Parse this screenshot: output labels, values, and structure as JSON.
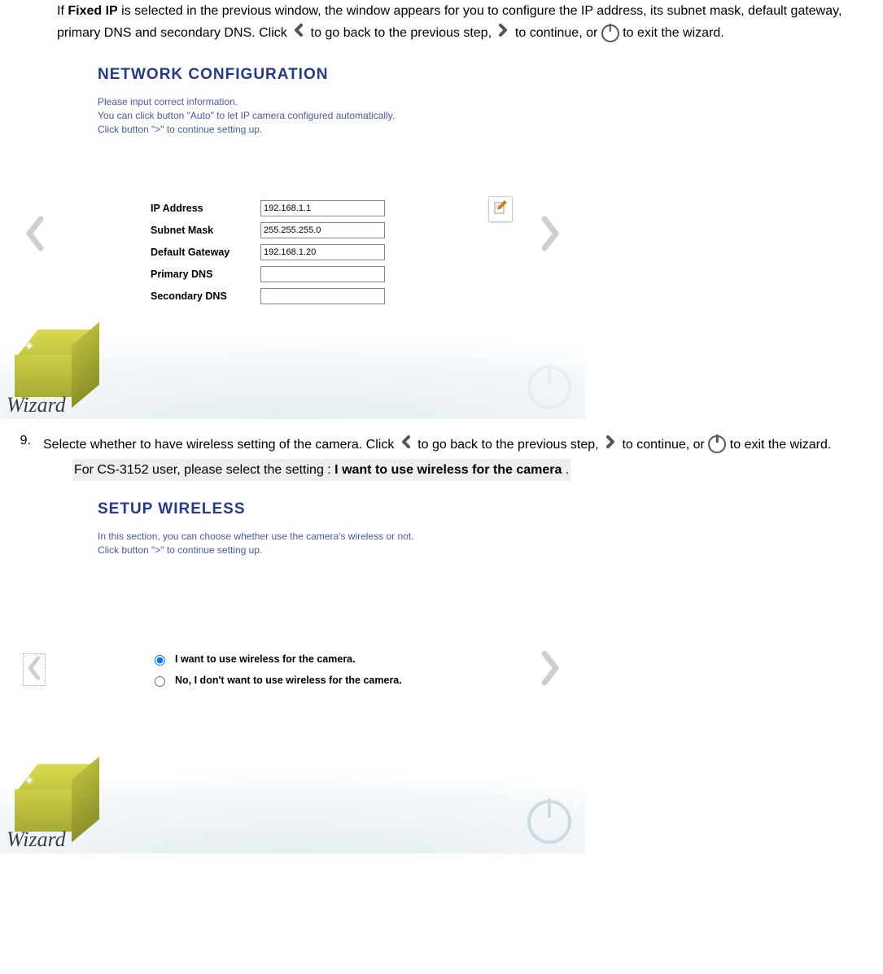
{
  "para1": {
    "p1a": "If ",
    "p1b": "Fixed IP",
    "p1c": " is selected in the previous window, the window appears for you to configure the IP address, its subnet mask, default gateway, primary DNS and secondary DNS. Click ",
    "p1d": "to go back to the previous step, ",
    "p1e": "to continue, or ",
    "p1f": " to exit the wizard."
  },
  "screenshot1": {
    "title": "NETWORK CONFIGURATION",
    "desc1": "Please input correct information.",
    "desc2": "You can click button \"Auto\" to let IP camera configured automatically.",
    "desc3": "Click button \">\" to continue setting up.",
    "fields": {
      "ip_label": "IP Address",
      "ip_value": "192.168.1.1",
      "subnet_label": "Subnet Mask",
      "subnet_value": "255.255.255.0",
      "gateway_label": "Default Gateway",
      "gateway_value": "192.168.1.20",
      "pdns_label": "Primary DNS",
      "pdns_value": "",
      "sdns_label": "Secondary DNS",
      "sdns_value": ""
    },
    "logo_text": "Wizard"
  },
  "step9": {
    "num": "9.",
    "text_a": "Selecte whether to have wireless setting of the camera. Click ",
    "text_b": "to go back to the previous step, ",
    "text_c": " to continue, or ",
    "text_d": " to exit the wizard.",
    "hl_a": "For CS-3152 user, please select the setting : ",
    "hl_b": "I want to use wireless for the camera",
    "hl_c": " ."
  },
  "screenshot2": {
    "title": "SETUP WIRELESS",
    "desc1": "In this section, you can choose whether use the camera's wireless or not. Click button \">\" to continue setting up.",
    "radio1": "I want to use wireless for the camera.",
    "radio2": "No, I don't want to use wireless for the camera.",
    "logo_text": "Wizard"
  }
}
